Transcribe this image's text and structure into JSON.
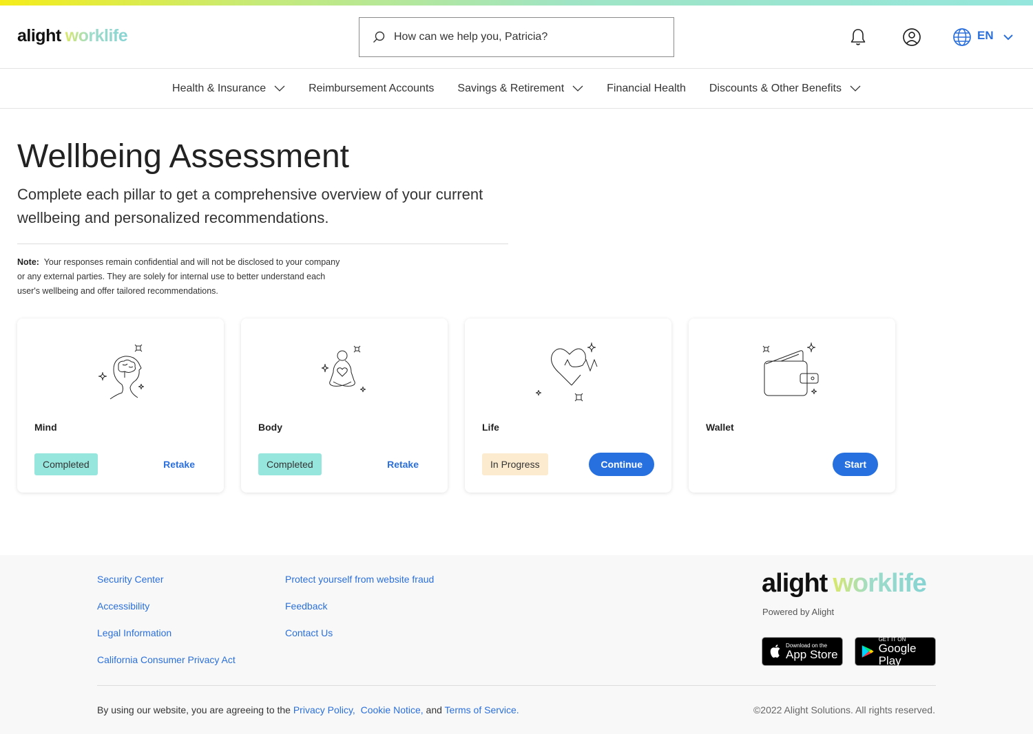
{
  "header": {
    "logo_primary": "alight",
    "logo_secondary": "worklife",
    "search_placeholder": "How can we help you, Patricia?",
    "icons": [
      "search-icon",
      "bell-icon",
      "user-icon",
      "globe-icon",
      "chevron-down-icon"
    ],
    "language": "EN"
  },
  "nav": {
    "items": [
      {
        "label": "Health & Insurance",
        "has_dropdown": true
      },
      {
        "label": "Reimbursement Accounts",
        "has_dropdown": false
      },
      {
        "label": "Savings & Retirement",
        "has_dropdown": true
      },
      {
        "label": "Financial Health",
        "has_dropdown": false
      },
      {
        "label": "Discounts & Other Benefits",
        "has_dropdown": true
      }
    ]
  },
  "main": {
    "title": "Wellbeing Assessment",
    "subtitle": "Complete each pillar to get a comprehensive overview of your current wellbeing and personalized recommendations.",
    "note_label": "Note:",
    "note_text": "Your responses remain confidential and will not be disclosed to your company or any external parties. They are solely for internal use to better understand each user's wellbeing and offer tailored recommendations.",
    "cards": [
      {
        "title": "Mind",
        "icon": "mind-head-icon",
        "status": "Completed",
        "action": "Retake"
      },
      {
        "title": "Body",
        "icon": "meditation-body-icon",
        "status": "Completed",
        "action": "Retake"
      },
      {
        "title": "Life",
        "icon": "heartbeat-life-icon",
        "status": "In Progress",
        "action": "Continue"
      },
      {
        "title": "Wallet",
        "icon": "wallet-icon",
        "status": "",
        "action": "Start"
      }
    ]
  },
  "colors": {
    "accent_blue": "#2670e0",
    "completed_badge": "#96e6de",
    "in_progress_badge": "#fcebcf"
  },
  "footer": {
    "col1": [
      "Security Center",
      "Accessibility",
      "Legal Information",
      "California Consumer Privacy Act"
    ],
    "col2": [
      "Protect yourself from website fraud",
      "Feedback",
      "Contact Us"
    ],
    "logo_primary": "alight",
    "logo_secondary": "worklife",
    "powered_by": "Powered by Alight",
    "app_store_small": "Download on the",
    "app_store_big": "App Store",
    "google_play_small": "GET IT ON",
    "google_play_big": "Google Play",
    "legal_prefix": "By using our website, you are agreeing to the",
    "legal_links": [
      "Privacy Policy,",
      "Cookie Notice,",
      "Terms of Service."
    ],
    "legal_and": "and",
    "copyright": "©2022 Alight Solutions. All rights reserved."
  }
}
